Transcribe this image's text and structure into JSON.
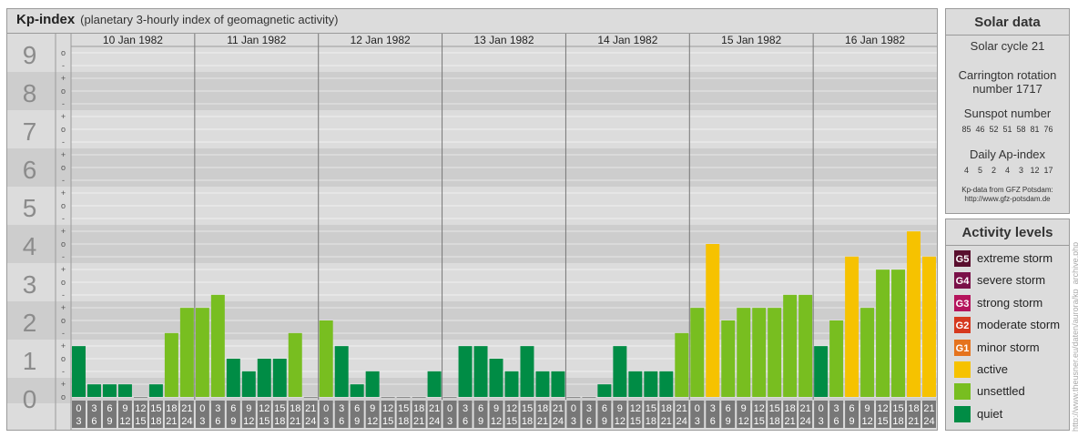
{
  "header": {
    "title": "Kp-index",
    "subtitle": "(planetary 3-hourly index of geomagnetic activity)"
  },
  "solar": {
    "title": "Solar data",
    "cycle": "Solar cycle 21",
    "carrington_line1": "Carrington rotation",
    "carrington_line2": "number 1717",
    "sunspot_title": "Sunspot number",
    "sunspot_values": [
      "85",
      "46",
      "52",
      "51",
      "58",
      "81",
      "76"
    ],
    "ap_title": "Daily Ap-index",
    "ap_values": [
      "4",
      "5",
      "2",
      "4",
      "3",
      "12",
      "17"
    ],
    "source_line1": "Kp-data from GFZ Potsdam:",
    "source_line2": "http://www.gfz-potsdam.de"
  },
  "levels": {
    "title": "Activity levels",
    "items": [
      {
        "code": "G5",
        "label": "extreme storm",
        "color": "#5a0f2e"
      },
      {
        "code": "G4",
        "label": "severe storm",
        "color": "#7a1048"
      },
      {
        "code": "G3",
        "label": "strong storm",
        "color": "#b5145c"
      },
      {
        "code": "G2",
        "label": "moderate storm",
        "color": "#d6391e"
      },
      {
        "code": "G1",
        "label": "minor storm",
        "color": "#e5731d"
      },
      {
        "code": "",
        "label": "active",
        "color": "#f6c200"
      },
      {
        "code": "",
        "label": "unsettled",
        "color": "#78be20"
      },
      {
        "code": "",
        "label": "quiet",
        "color": "#008c45"
      }
    ]
  },
  "watermark": "http://www.theusner.eu/daten/aurora/kp_archive.php",
  "chart_data": {
    "type": "bar",
    "title": "Kp-index",
    "ylim": [
      0,
      9
    ],
    "y_ticks": [
      "0",
      "1",
      "2",
      "3",
      "4",
      "5",
      "6",
      "7",
      "8",
      "9"
    ],
    "sub_ticks": [
      "-",
      "o",
      "+"
    ],
    "days": [
      "10 Jan 1982",
      "11 Jan 1982",
      "12 Jan 1982",
      "13 Jan 1982",
      "14 Jan 1982",
      "15 Jan 1982",
      "16 Jan 1982"
    ],
    "hour_top": [
      "0",
      "3",
      "6",
      "9",
      "12",
      "15",
      "18",
      "21"
    ],
    "hour_bottom": [
      "3",
      "6",
      "9",
      "12",
      "15",
      "18",
      "21",
      "24"
    ],
    "series": [
      {
        "values": [
          1.33,
          0.33,
          0.33,
          0.33,
          0,
          0.33,
          1.67,
          2.33,
          2.33,
          2.67,
          1.0,
          0.67,
          1.0,
          1.0,
          1.67,
          0,
          2.0,
          1.33,
          0.33,
          0.67,
          0,
          0,
          0,
          0.67,
          0,
          1.33,
          1.33,
          1.0,
          0.67,
          1.33,
          0.67,
          0.67,
          0,
          0,
          0.33,
          1.33,
          0.67,
          0.67,
          0.67,
          1.67,
          2.33,
          4.0,
          2.0,
          2.33,
          2.33,
          2.33,
          2.67,
          2.67,
          1.33,
          2.0,
          3.67,
          2.33,
          3.33,
          3.33,
          4.33,
          3.67
        ]
      }
    ],
    "colors": {
      "quiet": "#008c45",
      "unsettled": "#78be20",
      "active": "#f6c200"
    }
  }
}
